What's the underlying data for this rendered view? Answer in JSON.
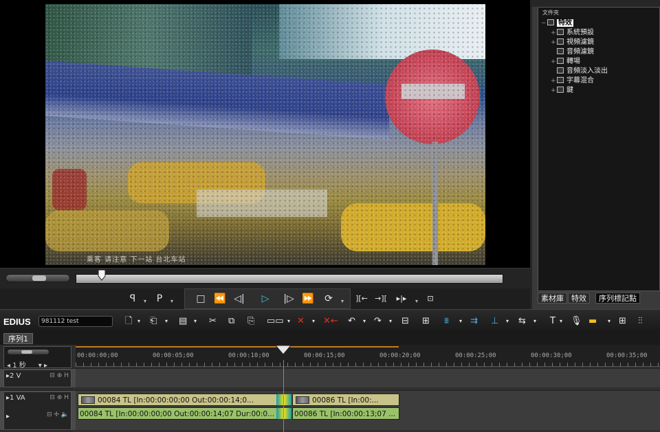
{
  "app": {
    "brand": "EDIUS",
    "project": "981112 test"
  },
  "preview": {
    "subtitle_text": "乘客 请注意 下一站 台北车站"
  },
  "transport": {
    "buttons": [
      "mark-in",
      "mark-out",
      "stop",
      "rewind",
      "step-back",
      "play",
      "step-forward",
      "fast-forward",
      "loop"
    ],
    "extra": [
      "insert",
      "overwrite",
      "extract",
      "tool"
    ]
  },
  "bin": {
    "header": "文件夾",
    "items": [
      {
        "label": "特效",
        "selected": true,
        "expander": "−"
      },
      {
        "label": "系統預設",
        "expander": "+"
      },
      {
        "label": "視頻濾鏡",
        "expander": "+"
      },
      {
        "label": "音頻濾鏡",
        "expander": ""
      },
      {
        "label": "轉場",
        "expander": "+"
      },
      {
        "label": "音頻淡入淡出",
        "expander": ""
      },
      {
        "label": "字幕混合",
        "expander": "+"
      },
      {
        "label": "鍵",
        "expander": "+"
      }
    ],
    "tabs": [
      "素材庫",
      "特效",
      "序列標記點"
    ]
  },
  "sequence": {
    "tab": "序列1",
    "scale": "1 秒"
  },
  "timecodes": [
    "00:00:00;00",
    "00:00:05;00",
    "00:00:10;00",
    "00:00:15;00",
    "00:00:20;00",
    "00:00:25;00",
    "00:00:30;00",
    "00:00:35;00"
  ],
  "tracks": {
    "v2": {
      "label": "2 V"
    },
    "va1": {
      "label": "1 VA"
    }
  },
  "clips": {
    "v1_a": "00084  TL [In:00:00:00;00 Out:00:00:14;0...",
    "v1_b": "00086  TL [In:00:...",
    "a1_a": "00084  TL [In:00:00:00;00 Out:00:00:14;07 Dur:00:0...",
    "a1_b": "00086  TL [In:00:00:13;07 ..."
  }
}
